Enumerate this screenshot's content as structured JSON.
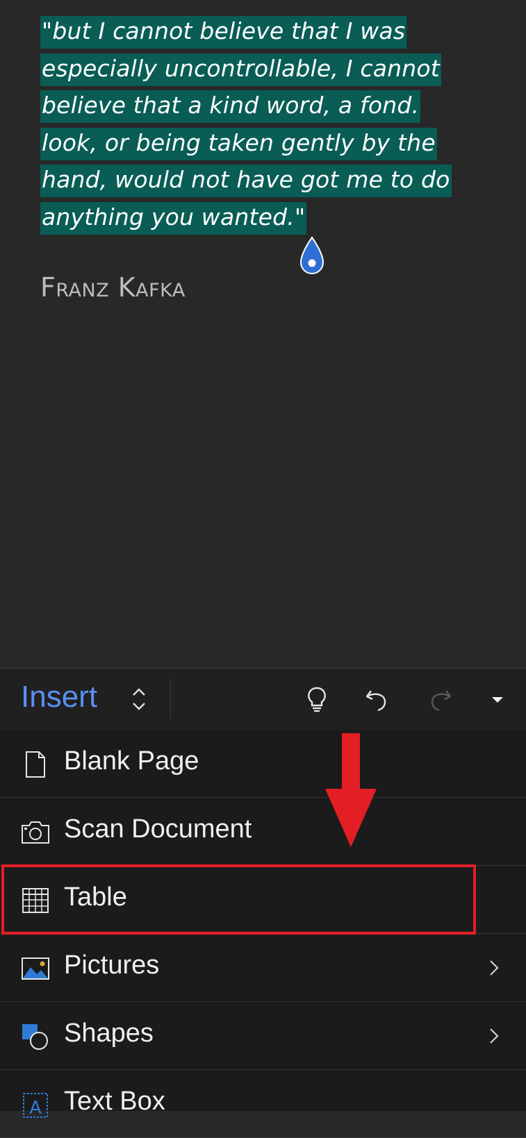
{
  "document": {
    "quote_lines": [
      "\"but I cannot believe that I was",
      "especially uncontrollable, I cannot",
      "believe that a kind word, a fond.",
      "look, or being taken gently by the",
      "hand, would not have got me to do",
      "anything you wanted.\""
    ],
    "author": "Franz Kafka",
    "selection_color": "#095d55"
  },
  "toolbar": {
    "tab_label": "Insert",
    "accent_color": "#5c8ef0",
    "icons": [
      "lightbulb-icon",
      "undo-icon",
      "redo-icon",
      "dropdown-caret-icon"
    ]
  },
  "menu": {
    "items": [
      {
        "label": "Blank Page",
        "icon": "blank-page-icon",
        "has_submenu": false
      },
      {
        "label": "Scan Document",
        "icon": "camera-icon",
        "has_submenu": false
      },
      {
        "label": "Table",
        "icon": "table-icon",
        "has_submenu": false
      },
      {
        "label": "Pictures",
        "icon": "pictures-icon",
        "has_submenu": true
      },
      {
        "label": "Shapes",
        "icon": "shapes-icon",
        "has_submenu": true
      },
      {
        "label": "Text Box",
        "icon": "text-box-icon",
        "has_submenu": false
      }
    ]
  },
  "annotation": {
    "highlight_color": "#e31e24",
    "target": "Table"
  }
}
